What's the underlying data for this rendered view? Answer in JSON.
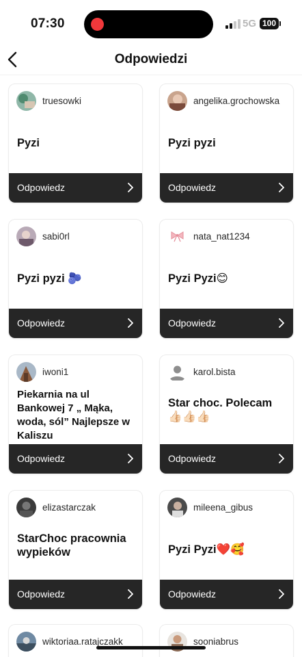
{
  "status_bar": {
    "time": "07:30",
    "network": "5G",
    "battery": "100"
  },
  "header": {
    "title": "Odpowiedzi",
    "back_icon": "chevron-left-icon"
  },
  "reply_label": "Odpowiedz",
  "cards": [
    {
      "username": "truesowki",
      "answer": "Pyzi"
    },
    {
      "username": "angelika.grochowska",
      "answer": "Pyzi pyzi"
    },
    {
      "username": "sabi0rl",
      "answer": "Pyzi pyzi 🫐"
    },
    {
      "username": "nata_nat1234",
      "answer": "Pyzi Pyzi😊"
    },
    {
      "username": "iwoni1",
      "answer": "Piekarnia na ul Bankowej 7 „ Mąka, woda, sól” Najlepsze w Kaliszu"
    },
    {
      "username": "karol.bista",
      "answer": "Star choc. Polecam 👍🏻👍🏻👍🏻"
    },
    {
      "username": "elizastarczak",
      "answer": "StarChoc pracownia wypieków"
    },
    {
      "username": "mileena_gibus",
      "answer": "Pyzi Pyzi❤️🥰"
    },
    {
      "username": "wiktoriaa.ratajczakk"
    },
    {
      "username": "sooniabrus"
    }
  ]
}
